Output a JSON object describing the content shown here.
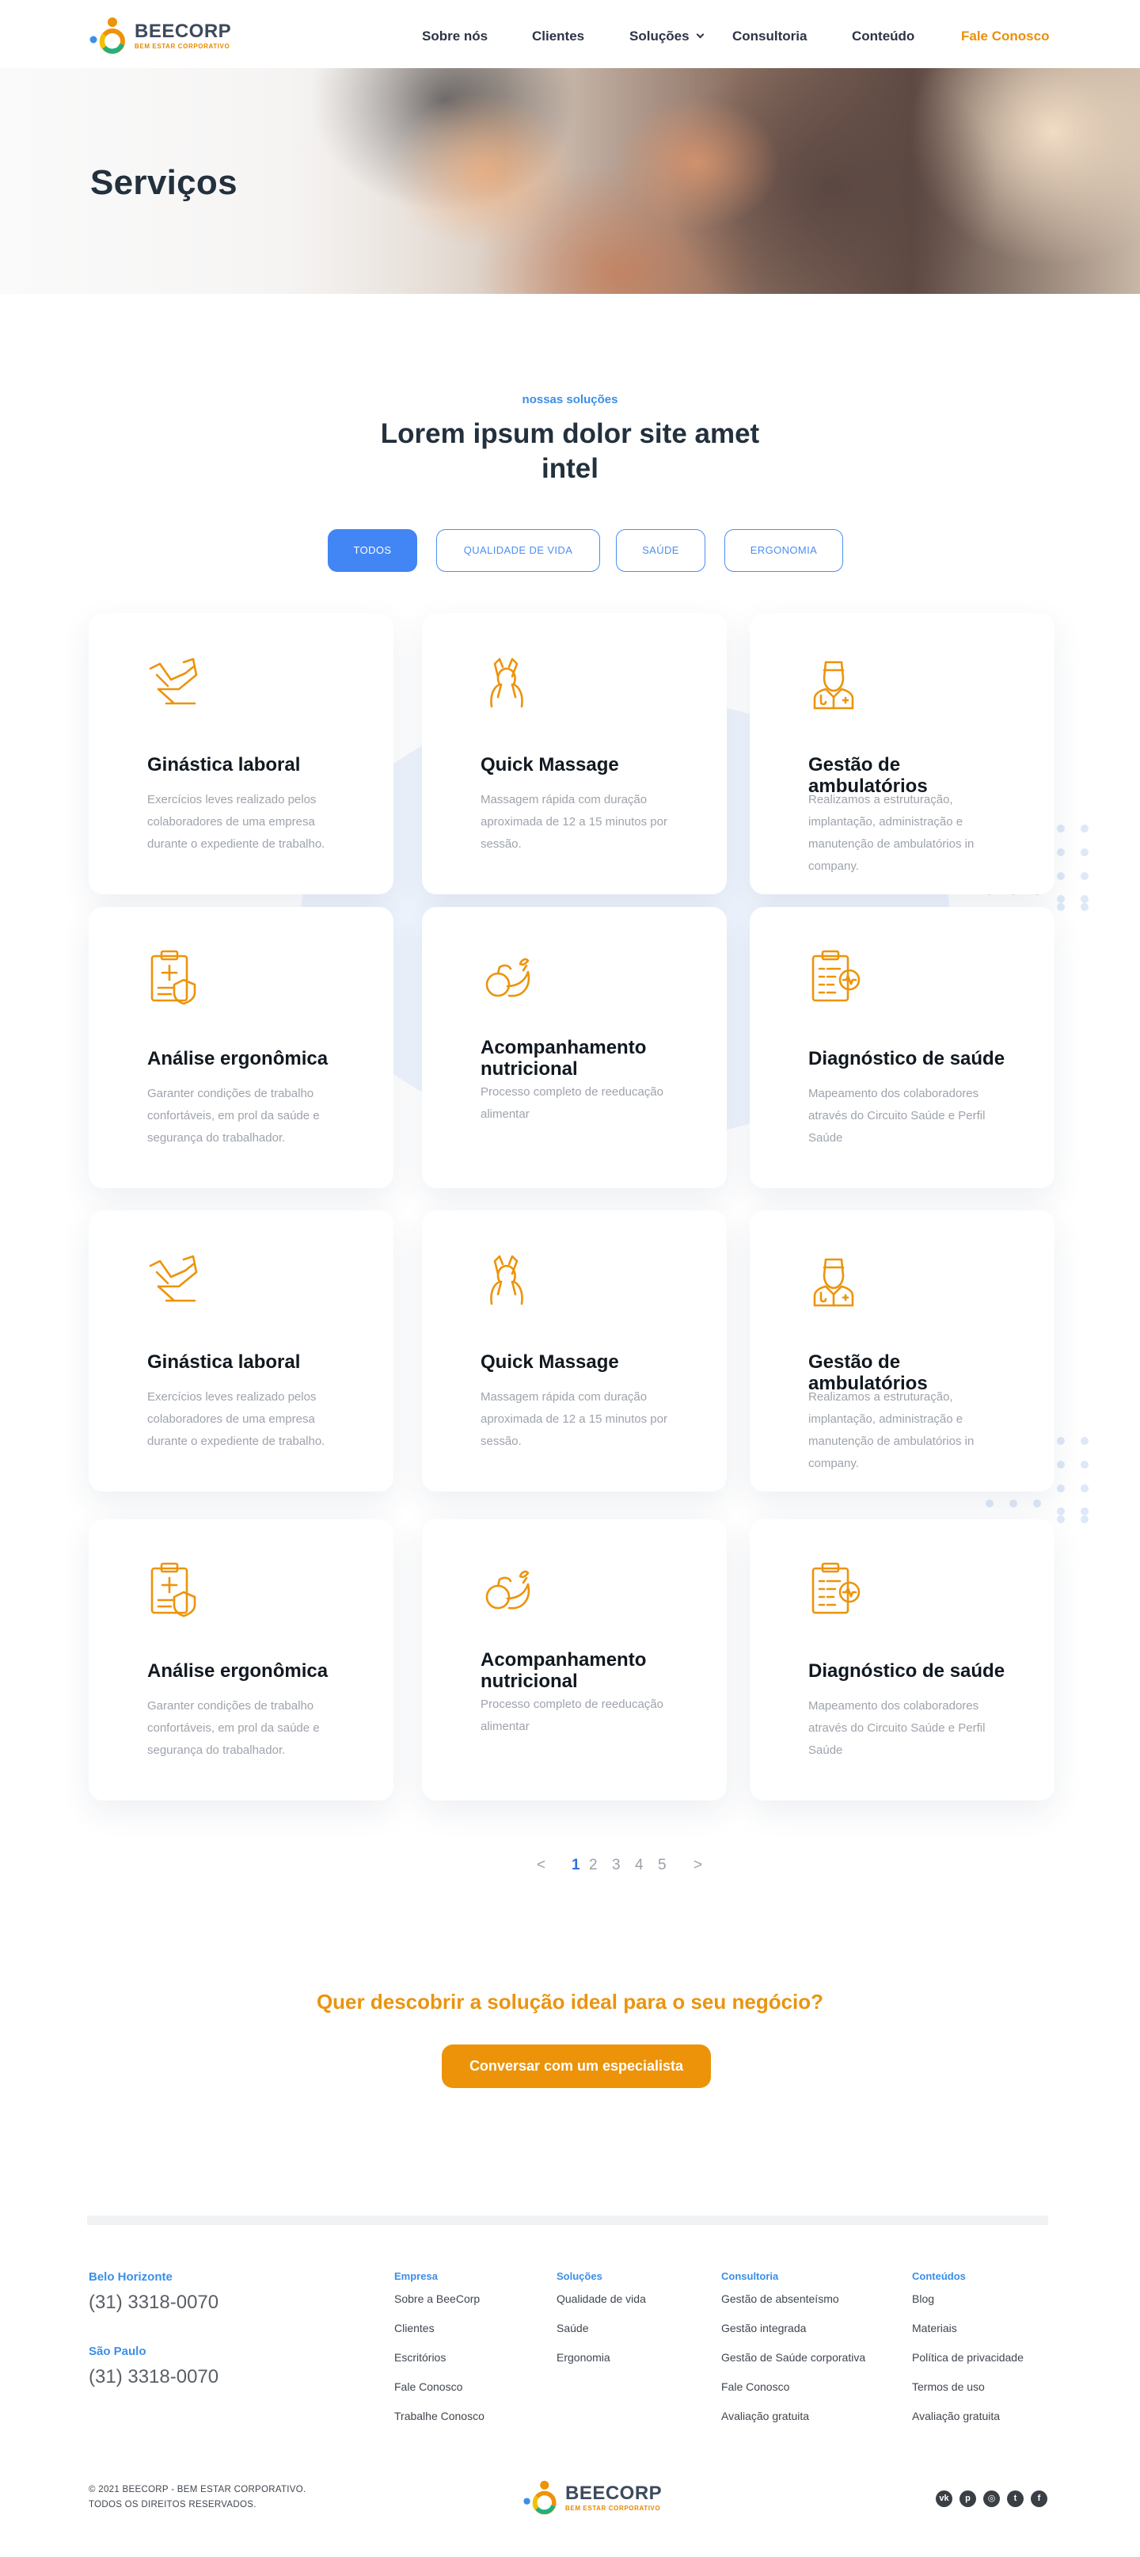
{
  "brand": {
    "name": "BEECORP",
    "tagline": "BEM ESTAR CORPORATIVO"
  },
  "nav": {
    "items": [
      "Sobre nós",
      "Clientes",
      "Soluções",
      "Consultoria",
      "Conteúdo"
    ],
    "cta": "Fale Conosco"
  },
  "hero": {
    "title": "Serviços"
  },
  "section": {
    "eyebrow": "nossas soluções",
    "title": "Lorem ipsum dolor site amet intel"
  },
  "filters": {
    "items": [
      "TODOS",
      "QUALIDADE DE VIDA",
      "SAÚDE",
      "ERGONOMIA"
    ],
    "active": "TODOS"
  },
  "cards": [
    {
      "title": "Ginástica laboral",
      "desc": "Exercícios leves realizado pelos colaboradores de uma empresa durante o expediente de trabalho.",
      "icon": "exercise-icon"
    },
    {
      "title": "Quick  Massage",
      "desc": "Massagem rápida com duração aproximada de 12 a 15 minutos por sessão.",
      "icon": "massage-icon"
    },
    {
      "title": "Gestão de ambulatórios",
      "desc": "Realizamos a estruturação, implantação, administração e manutenção de ambulatórios in company.",
      "icon": "doctor-icon"
    },
    {
      "title": "Análise ergonômica",
      "desc": "Garanter condições de trabalho confortáveis, em prol da saúde e segurança do trabalhador.",
      "icon": "clipboard-shield-icon"
    },
    {
      "title": "Acompanhamento nutricional",
      "desc": "Processo completo de reeducação alimentar",
      "icon": "fruits-icon"
    },
    {
      "title": "Diagnóstico de saúde",
      "desc": "Mapeamento dos colaboradores através do Circuito Saúde e Perfil Saúde",
      "icon": "clipboard-heart-icon"
    },
    {
      "title": "Ginástica laboral",
      "desc": "Exercícios leves realizado pelos colaboradores de uma empresa durante o expediente de trabalho.",
      "icon": "exercise-icon"
    },
    {
      "title": "Quick  Massage",
      "desc": "Massagem rápida com duração aproximada de 12 a 15 minutos por sessão.",
      "icon": "massage-icon"
    },
    {
      "title": "Gestão de ambulatórios",
      "desc": "Realizamos a estruturação, implantação, administração e manutenção de ambulatórios in company.",
      "icon": "doctor-icon"
    },
    {
      "title": "Análise ergonômica",
      "desc": "Garanter condições de trabalho confortáveis, em prol da saúde e segurança do trabalhador.",
      "icon": "clipboard-shield-icon"
    },
    {
      "title": "Acompanhamento nutricional",
      "desc": "Processo completo de reeducação alimentar",
      "icon": "fruits-icon"
    },
    {
      "title": "Diagnóstico de saúde",
      "desc": "Mapeamento dos colaboradores através do Circuito Saúde e Perfil Saúde",
      "icon": "clipboard-heart-icon"
    }
  ],
  "pagination": {
    "prev": "<",
    "pages": [
      "1",
      "2",
      "3",
      "4",
      "5"
    ],
    "current": "1",
    "next": ">"
  },
  "cta": {
    "title": "Quer descobrir a solução ideal para o seu negócio?",
    "button": "Conversar com um especialista"
  },
  "footer": {
    "offices": [
      {
        "city": "Belo Horizonte",
        "phone": "(31) 3318-0070"
      },
      {
        "city": "São Paulo",
        "phone": "(31) 3318-0070"
      }
    ],
    "columns": [
      {
        "title": "Empresa",
        "links": [
          "Sobre a BeeCorp",
          "Clientes",
          "Escritórios",
          "Fale Conosco",
          "Trabalhe Conosco"
        ]
      },
      {
        "title": "Soluções",
        "links": [
          "Qualidade de vida",
          "Saúde",
          "Ergonomia"
        ]
      },
      {
        "title": "Consultoria",
        "links": [
          "Gestão de absenteísmo",
          "Gestão integrada",
          "Gestão de Saúde corporativa",
          "Fale Conosco",
          "Avaliação gratuita"
        ]
      },
      {
        "title": "Conteúdos",
        "links": [
          "Blog",
          "Materiais",
          "Política de privacidade",
          "Termos de uso",
          "Avaliação gratuita"
        ]
      }
    ],
    "copyright_line1": "© 2021 BEECORP - BEM ESTAR CORPORATIVO.",
    "copyright_line2": "TODOS OS DIREITOS RESERVADOS.",
    "socials": [
      "vk-icon",
      "pinterest-icon",
      "instagram-icon",
      "twitter-icon",
      "facebook-icon"
    ]
  },
  "colors": {
    "accent_orange": "#ed930a",
    "accent_blue": "#4285f4",
    "heading": "#23303d"
  }
}
